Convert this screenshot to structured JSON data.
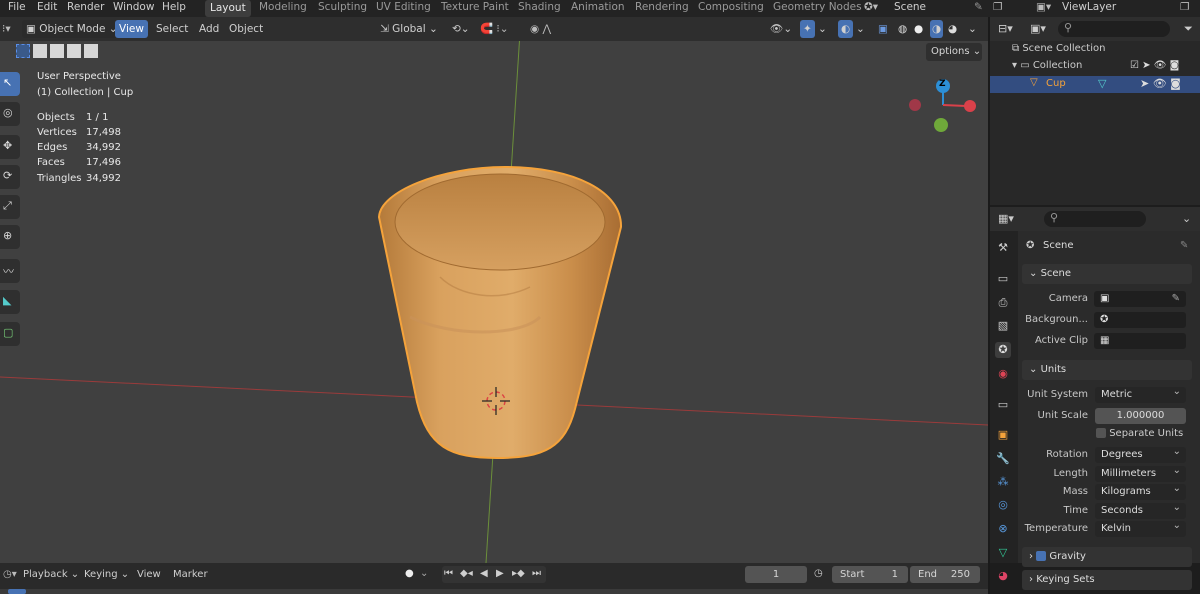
{
  "topbar": {
    "menus": [
      "File",
      "Edit",
      "Render",
      "Window",
      "Help"
    ],
    "workspaces": [
      "Layout",
      "Modeling",
      "Sculpting",
      "UV Editing",
      "Texture Paint",
      "Shading",
      "Animation",
      "Rendering",
      "Compositing",
      "Geometry Nodes"
    ],
    "scene": "Scene",
    "view_layer": "ViewLayer"
  },
  "viewport_header": {
    "mode": "Object Mode",
    "menus": [
      "View",
      "Select",
      "Add",
      "Object"
    ],
    "orientation": "Global",
    "options_label": "Options"
  },
  "overlay": {
    "perspective": "User Perspective",
    "context": "(1) Collection | Cup",
    "stats": [
      {
        "label": "Objects",
        "value": "1 / 1"
      },
      {
        "label": "Vertices",
        "value": "17,498"
      },
      {
        "label": "Edges",
        "value": "34,992"
      },
      {
        "label": "Faces",
        "value": "17,496"
      },
      {
        "label": "Triangles",
        "value": "34,992"
      }
    ]
  },
  "gizmo": {
    "z_label": "Z"
  },
  "outliner": {
    "scene_collection": "Scene Collection",
    "collection": "Collection",
    "object": "Cup"
  },
  "properties": {
    "header": "Scene",
    "scene_panel": "Scene",
    "camera_label": "Camera",
    "background_label": "Backgroun...",
    "active_clip_label": "Active Clip",
    "units_panel": "Units",
    "unit_system_label": "Unit System",
    "unit_system": "Metric",
    "unit_scale_label": "Unit Scale",
    "unit_scale": "1.000000",
    "separate_units": "Separate Units",
    "rotation_label": "Rotation",
    "rotation": "Degrees",
    "length_label": "Length",
    "length": "Millimeters",
    "mass_label": "Mass",
    "mass": "Kilograms",
    "time_label": "Time",
    "time": "Seconds",
    "temperature_label": "Temperature",
    "temperature": "Kelvin",
    "gravity": "Gravity",
    "keying_sets": "Keying Sets"
  },
  "timeline": {
    "playback": "Playback",
    "keying": "Keying",
    "view": "View",
    "marker": "Marker",
    "current_frame": "1",
    "start_label": "Start",
    "start": "1",
    "end_label": "End",
    "end": "250"
  },
  "colors": {
    "accent": "#4772b3",
    "selection": "#f5a33b",
    "x_axis": "#d9414a",
    "y_axis": "#8bc34a",
    "z_axis": "#2c8fd6"
  }
}
